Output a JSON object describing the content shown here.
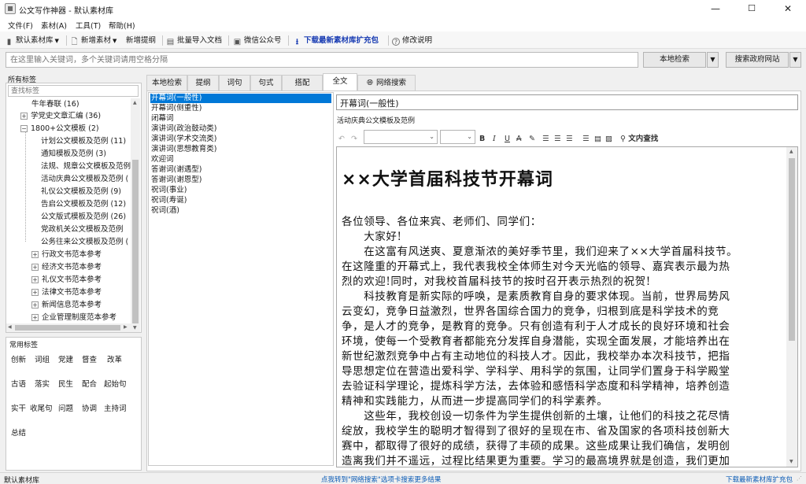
{
  "window": {
    "title": "公文写作神器 - 默认素材库",
    "minimize": "—",
    "maximize": "☐",
    "close": "✕"
  },
  "menu": [
    "文件(F)",
    "素材(A)",
    "工具(T)",
    "帮助(H)"
  ],
  "toolbar": {
    "library": "默认素材库",
    "new_material": "新增素材",
    "new_outline": "新增提纲",
    "batch_import": "批量导入文档",
    "wechat": "微信公众号",
    "download": "下载最新素材库扩充包",
    "changelog": "修改说明"
  },
  "search": {
    "placeholder": "在这里输入关键词，多个关键词请用空格分隔",
    "local_btn": "本地检索",
    "gov_btn": "搜索政府网站",
    "dropdown": "▼"
  },
  "left": {
    "all_tags_label": "所有标签",
    "filter_placeholder": "查找标签",
    "tree": [
      {
        "label": "牛年春联  (16)"
      },
      {
        "label": "学党史文章汇编  (36)"
      },
      {
        "label": "1800+公文模板  (2)"
      },
      {
        "label": "计划公文模板及范例  (11)"
      },
      {
        "label": "通知模板及范例  (3)"
      },
      {
        "label": "法规、规章公文模板及范例"
      },
      {
        "label": "活动庆典公文模板及范例  ("
      },
      {
        "label": "礼仪公文模板及范例  (9)"
      },
      {
        "label": "告启公文模板及范例  (12)"
      },
      {
        "label": "公文版式模板及范例  (26)"
      },
      {
        "label": "党政机关公文模板及范例"
      },
      {
        "label": "公务往来公文模板及范例  ("
      },
      {
        "label": "行政文书范本参考"
      },
      {
        "label": "经济文书范本参考"
      },
      {
        "label": "礼仪文书范本参考"
      },
      {
        "label": "法律文书范本参考"
      },
      {
        "label": "新闻信息范本参考"
      },
      {
        "label": "企业管理制度范本参考"
      }
    ],
    "common_tags_label": "常用标签",
    "common_tags": [
      [
        "创新",
        "词组",
        "党建",
        "督查",
        "改革"
      ],
      [
        "古语",
        "落实",
        "民生",
        "配合",
        "起始句"
      ],
      [
        "实干",
        "收尾句",
        "问题",
        "协调",
        "主持词"
      ],
      [
        "总结"
      ]
    ]
  },
  "tabs": [
    "本地检索",
    "提纲",
    "词句",
    "句式",
    "搭配",
    "全文",
    "网络搜索"
  ],
  "list": [
    "开幕词(一般性)",
    "开幕词(侧重性)",
    "闭幕词",
    "演讲词(政治鼓动类)",
    "演讲词(学术交流类)",
    "演讲词(思想教育类)",
    "欢迎词",
    "答谢词(谢遇型)",
    "答谢词(谢恩型)",
    "祝词(事业)",
    "祝词(寿诞)",
    "祝词(酒)"
  ],
  "editor": {
    "title": "开幕词(一般性)",
    "category": "活动庆典公文模板及范例",
    "find_label": "文内查找",
    "doc_title": "××大学首届科技节开幕词",
    "doc_lines": [
      "各位领导、各位来宾、老师们、同学们：",
      "　　大家好!",
      "　　在这富有风送爽、夏意渐浓的美好季节里，我们迎来了××大学首届科技节。",
      "在这隆重的开幕式上，我代表我校全体师生对今天光临的领导、嘉宾表示最为热",
      "烈的欢迎!同时，对我校首届科技节的按时召开表示热烈的祝贺!",
      "　　科技教育是新实际的呼唤，是素质教育自身的要求体现。当前，世界局势风",
      "云变幻，竞争日益激烈，世界各国综合国力的竞争，归根到底是科学技术的竞",
      "争，是人才的竞争，是教育的竞争。只有创造有利于人才成长的良好环境和社会",
      "环境，使每一个受教育者都能充分发挥自身潜能，实现全面发展，才能培养出在",
      "新世纪激烈竞争中占有主动地位的科技人才。因此，我校举办本次科技节，把指",
      "导思想定位在营造出爱科学、学科学、用科学的氛围，让同学们置身于科学殿堂",
      "去验证科学理论，提炼科学方法，去体验和感悟科学态度和科学精神，培养创造",
      "精神和实践能力，从而进一步提高同学们的科学素养。",
      "　　这些年，我校创设一切条件为学生提供创新的土壤，让他们的科技之花尽情",
      "绽放，我校学生的聪明才智得到了很好的呈现在市、省及国家的各项科技创新大",
      "赛中，都取得了很好的成绩，获得了丰硕的成果。这些成果让我们确信，发明创",
      "造离我们并不遥远，过程比结果更为重要。学习的最高境界就是创造，我们更加"
    ]
  },
  "status": {
    "left": "默认素材库",
    "center": "点我转到\"网络搜索\"选项卡搜索更多结果",
    "right": "下载最新素材库扩充包"
  },
  "colors": {
    "accent": "#0078d7",
    "link": "#0b5bb5",
    "download": "#1a3db3"
  }
}
